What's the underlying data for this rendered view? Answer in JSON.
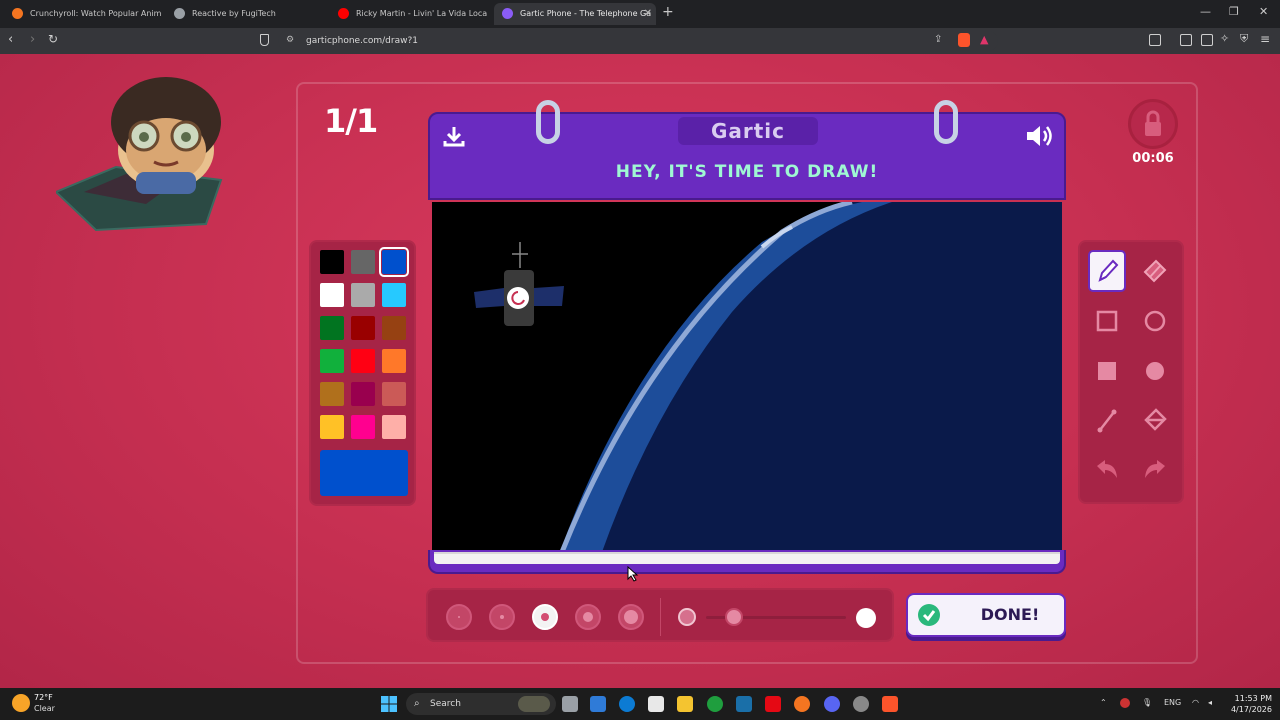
{
  "browser": {
    "tabs": [
      {
        "label": "Crunchyroll: Watch Popular Anime, Pl",
        "favicon_color": "#f47521",
        "active": false
      },
      {
        "label": "Reactive by FugiTech",
        "favicon_color": "#9aa0a6",
        "active": false
      },
      {
        "label": "Ricky Martin - Livin' La Vida Loca (au",
        "favicon_color": "#ff0000",
        "active": false
      },
      {
        "label": "Gartic Phone - The Telephone Ga",
        "favicon_color": "#8b5cf6",
        "active": true
      }
    ],
    "url": "garticphone.com/draw?1"
  },
  "game": {
    "round": "1/1",
    "timer": "00:06",
    "logo": "Gartic",
    "prompt": "HEY, IT'S TIME TO DRAW!",
    "done_label": "DONE!",
    "palette": [
      "#000000",
      "#666666",
      "#0050cd",
      "#ffffff",
      "#aaaaaa",
      "#26c9ff",
      "#017420",
      "#990000",
      "#964112",
      "#11b03c",
      "#ff0013",
      "#ff7829",
      "#b0701c",
      "#99004e",
      "#cb5a57",
      "#ffc126",
      "#ff008f",
      "#feafa8"
    ],
    "selected_color": "#0050cd",
    "brush_sizes": 5,
    "selected_brush_size_index": 2,
    "opacity_level": 0.2,
    "tools": [
      "pencil-icon",
      "eraser-icon",
      "rectangle-outline-icon",
      "circle-outline-icon",
      "rectangle-filled-icon",
      "circle-filled-icon",
      "line-icon",
      "fill-bucket-icon",
      "undo-icon",
      "redo-icon"
    ],
    "selected_tool": "pencil-icon"
  },
  "taskbar": {
    "weather_temp": "72°F",
    "weather_desc": "Clear",
    "search_label": "Search",
    "lang": "ENG",
    "time": "11:53 PM",
    "date": "4/17/2026"
  }
}
